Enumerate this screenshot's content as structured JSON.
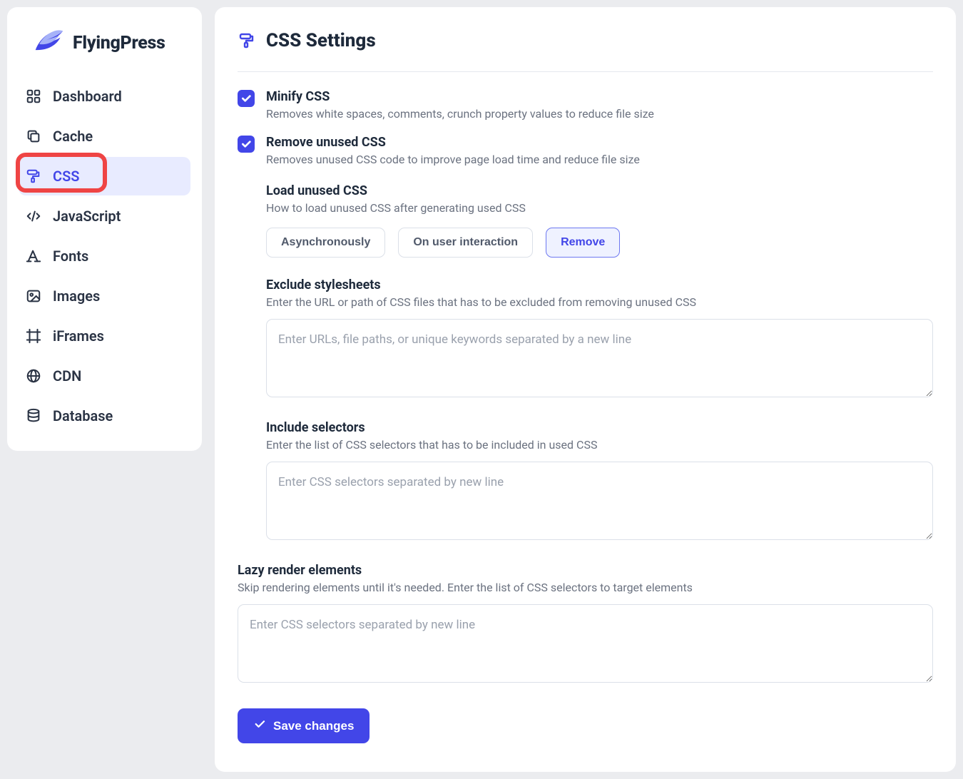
{
  "brand": {
    "name": "FlyingPress"
  },
  "sidebar": {
    "items": [
      {
        "id": "dashboard",
        "label": "Dashboard"
      },
      {
        "id": "cache",
        "label": "Cache"
      },
      {
        "id": "css",
        "label": "CSS"
      },
      {
        "id": "javascript",
        "label": "JavaScript"
      },
      {
        "id": "fonts",
        "label": "Fonts"
      },
      {
        "id": "images",
        "label": "Images"
      },
      {
        "id": "iframes",
        "label": "iFrames"
      },
      {
        "id": "cdn",
        "label": "CDN"
      },
      {
        "id": "database",
        "label": "Database"
      }
    ],
    "active_id": "css",
    "highlight_id": "css"
  },
  "page": {
    "title": "CSS Settings"
  },
  "settings": {
    "minify": {
      "checked": true,
      "title": "Minify CSS",
      "desc": "Removes white spaces, comments, crunch property values to reduce file size"
    },
    "remove_unused": {
      "checked": true,
      "title": "Remove unused CSS",
      "desc": "Removes unused CSS code to improve page load time and reduce file size"
    },
    "load_unused": {
      "title": "Load unused CSS",
      "desc": "How to load unused CSS after generating used CSS",
      "options": [
        "Asynchronously",
        "On user interaction",
        "Remove"
      ],
      "selected": "Remove"
    },
    "exclude_styles": {
      "title": "Exclude stylesheets",
      "desc": "Enter the URL or path of CSS files that has to be excluded from removing unused CSS",
      "placeholder": "Enter URLs, file paths, or unique keywords separated by a new line",
      "value": ""
    },
    "include_selectors": {
      "title": "Include selectors",
      "desc": "Enter the list of CSS selectors that has to be included in used CSS",
      "placeholder": "Enter CSS selectors separated by new line",
      "value": ""
    },
    "lazy_render": {
      "title": "Lazy render elements",
      "desc": "Skip rendering elements until it's needed. Enter the list of CSS selectors to target elements",
      "placeholder": "Enter CSS selectors separated by new line",
      "value": ""
    }
  },
  "actions": {
    "save_label": "Save changes"
  },
  "colors": {
    "accent": "#4246e8",
    "highlight": "#ef4444"
  }
}
